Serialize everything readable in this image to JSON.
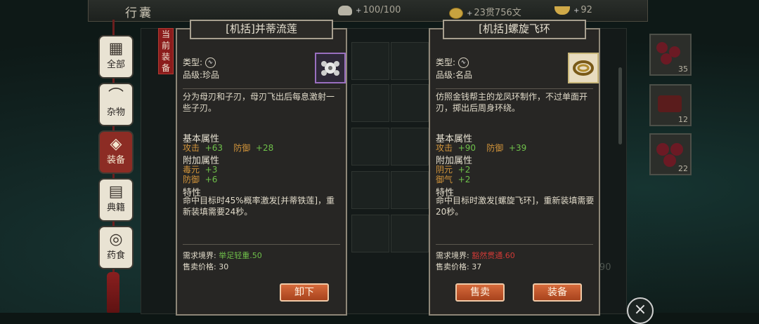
{
  "topbar": {
    "title": "行囊",
    "bag": "100/100",
    "money": "23贯756文",
    "ingot": "92"
  },
  "categories": [
    {
      "label": "全部",
      "icon": "grid-icon",
      "glyph": "▦"
    },
    {
      "label": "杂物",
      "icon": "fan-icon",
      "glyph": "⌒"
    },
    {
      "label": "装备",
      "icon": "armor-icon",
      "glyph": "◈"
    },
    {
      "label": "典籍",
      "icon": "book-icon",
      "glyph": "▤"
    },
    {
      "label": "药食",
      "icon": "food-icon",
      "glyph": "◎"
    }
  ],
  "equipped_badge": "当前装备",
  "right_items": [
    {
      "count": "35"
    },
    {
      "count": "12"
    },
    {
      "count": "22"
    }
  ],
  "bottom_count": "89/90",
  "left_item": {
    "name": "[机括]并蒂流莲",
    "type_label": "类型:",
    "grade_label": "品级:",
    "grade": "珍品",
    "description": "分为母刃和子刃，母刃飞出后每息激射一些子刃。",
    "basic_title": "基本属性",
    "basic": [
      {
        "name": "攻击",
        "value": "+63"
      },
      {
        "name": "防御",
        "value": "+28"
      }
    ],
    "extra_title": "附加属性",
    "extra": [
      {
        "name": "毒元",
        "value": "+3"
      },
      {
        "name": "防御",
        "value": "+6"
      }
    ],
    "trait_title": "特性",
    "trait": "命中目标时45%概率激发[并蒂铁莲]，重新装填需要24秒。",
    "req_label": "需求境界:",
    "req_value": "举足轻重.50",
    "req_color": "#6fc04a",
    "price_label": "售卖价格:",
    "price": "30",
    "buttons": [
      "卸下"
    ],
    "frame_color": "#9a6fc0"
  },
  "right_item": {
    "name": "[机括]螺旋飞环",
    "type_label": "类型:",
    "grade_label": "品级:",
    "grade": "名品",
    "description": "仿照金钱帮主的龙凤环制作，不过单面开刃，掷出后周身环绕。",
    "basic_title": "基本属性",
    "basic": [
      {
        "name": "攻击",
        "value": "+90"
      },
      {
        "name": "防御",
        "value": "+39"
      }
    ],
    "extra_title": "附加属性",
    "extra": [
      {
        "name": "阴元",
        "value": "+2"
      },
      {
        "name": "御气",
        "value": "+2"
      }
    ],
    "trait_title": "特性",
    "trait": "命中目标时激发[螺旋飞环]，重新装填需要20秒。",
    "req_label": "需求境界:",
    "req_value": "豁然贯通.60",
    "req_color": "#d13a36",
    "price_label": "售卖价格:",
    "price": "37",
    "buttons": [
      "售卖",
      "装备"
    ],
    "frame_color": "#c9b77a"
  }
}
